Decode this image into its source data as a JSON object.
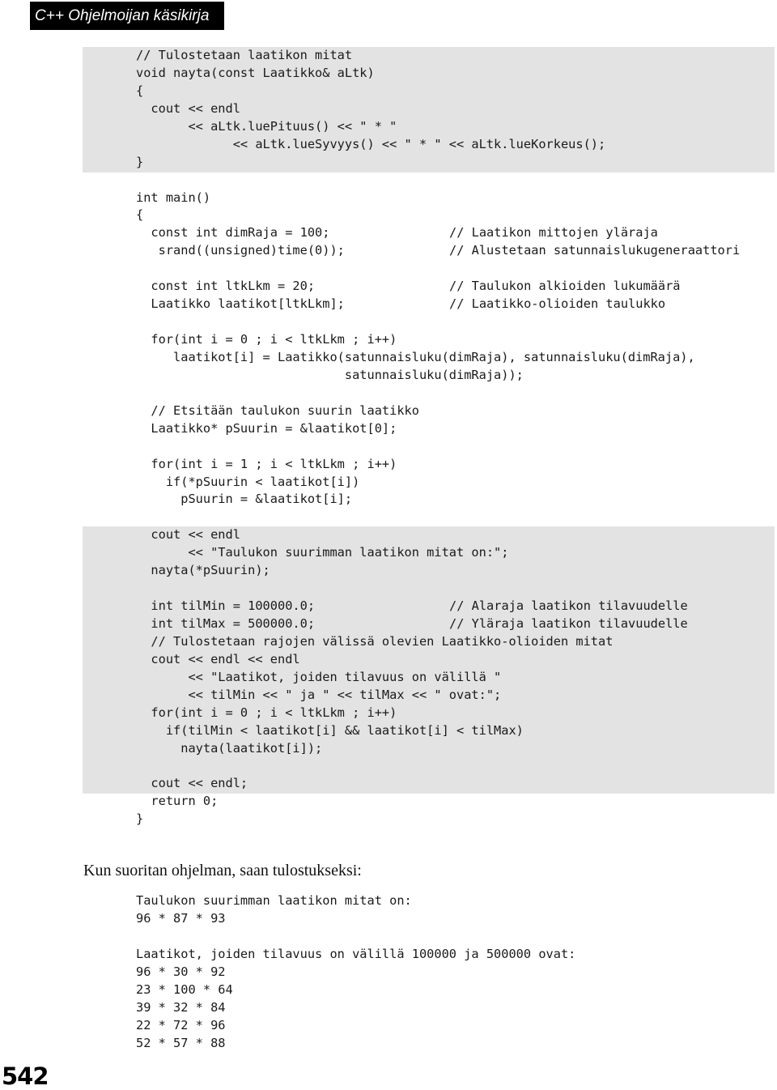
{
  "header": {
    "title": "C++ Ohjelmoijan käsikirja"
  },
  "code_listing": {
    "lines": [
      {
        "text": "// Tulostetaan laatikon mitat",
        "comment": ""
      },
      {
        "text": "void nayta(const Laatikko& aLtk)",
        "comment": ""
      },
      {
        "text": "{",
        "comment": ""
      },
      {
        "text": "  cout << endl",
        "comment": ""
      },
      {
        "text": "       << aLtk.luePituus() << \" * \"",
        "comment": ""
      },
      {
        "text": "             << aLtk.lueSyvyys() << \" * \" << aLtk.lueKorkeus();",
        "comment": ""
      },
      {
        "text": "}",
        "comment": ""
      },
      {
        "text": "",
        "comment": ""
      },
      {
        "text": "int main()",
        "comment": ""
      },
      {
        "text": "{",
        "comment": ""
      },
      {
        "text": "  const int dimRaja = 100;",
        "comment": "// Laatikon mittojen yläraja"
      },
      {
        "text": "   srand((unsigned)time(0));",
        "comment": "// Alustetaan satunnaislukugeneraattori"
      },
      {
        "text": "",
        "comment": ""
      },
      {
        "text": "  const int ltkLkm = 20;",
        "comment": "// Taulukon alkioiden lukumäärä"
      },
      {
        "text": "  Laatikko laatikot[ltkLkm];",
        "comment": "// Laatikko-olioiden taulukko"
      },
      {
        "text": "",
        "comment": ""
      },
      {
        "text": "  for(int i = 0 ; i < ltkLkm ; i++)",
        "comment": ""
      },
      {
        "text": "     laatikot[i] = Laatikko(satunnaisluku(dimRaja), satunnaisluku(dimRaja),",
        "comment": ""
      },
      {
        "text": "                            satunnaisluku(dimRaja));",
        "comment": ""
      },
      {
        "text": "",
        "comment": ""
      },
      {
        "text": "  // Etsitään taulukon suurin laatikko",
        "comment": ""
      },
      {
        "text": "  Laatikko* pSuurin = &laatikot[0];",
        "comment": ""
      },
      {
        "text": "",
        "comment": ""
      },
      {
        "text": "  for(int i = 1 ; i < ltkLkm ; i++)",
        "comment": ""
      },
      {
        "text": "    if(*pSuurin < laatikot[i])",
        "comment": ""
      },
      {
        "text": "      pSuurin = &laatikot[i];",
        "comment": ""
      },
      {
        "text": "",
        "comment": ""
      },
      {
        "text": "  cout << endl",
        "comment": ""
      },
      {
        "text": "       << \"Taulukon suurimman laatikon mitat on:\";",
        "comment": ""
      },
      {
        "text": "  nayta(*pSuurin);",
        "comment": ""
      },
      {
        "text": "",
        "comment": ""
      },
      {
        "text": "  int tilMin = 100000.0;",
        "comment": "// Alaraja laatikon tilavuudelle"
      },
      {
        "text": "  int tilMax = 500000.0;",
        "comment": "// Yläraja laatikon tilavuudelle"
      },
      {
        "text": "  // Tulostetaan rajojen välissä olevien Laatikko-olioiden mitat",
        "comment": ""
      },
      {
        "text": "  cout << endl << endl",
        "comment": ""
      },
      {
        "text": "       << \"Laatikot, joiden tilavuus on välillä \"",
        "comment": ""
      },
      {
        "text": "       << tilMin << \" ja \" << tilMax << \" ovat:\";",
        "comment": ""
      },
      {
        "text": "  for(int i = 0 ; i < ltkLkm ; i++)",
        "comment": ""
      },
      {
        "text": "    if(tilMin < laatikot[i] && laatikot[i] < tilMax)",
        "comment": ""
      },
      {
        "text": "      nayta(laatikot[i]);",
        "comment": ""
      },
      {
        "text": "",
        "comment": ""
      },
      {
        "text": "  cout << endl;",
        "comment": ""
      },
      {
        "text": "  return 0;",
        "comment": ""
      },
      {
        "text": "}",
        "comment": ""
      }
    ]
  },
  "prose": {
    "text": "Kun suoritan ohjelman, saan tulostukseksi:"
  },
  "program_output": {
    "lines": [
      "Taulukon suurimman laatikon mitat on:",
      "96 * 87 * 93",
      "",
      "Laatikot, joiden tilavuus on välillä 100000 ja 500000 ovat:",
      "96 * 30 * 92",
      "23 * 100 * 64",
      "39 * 32 * 84",
      "22 * 72 * 96",
      "52 * 57 * 88"
    ]
  },
  "footer": {
    "page_number": "542"
  }
}
